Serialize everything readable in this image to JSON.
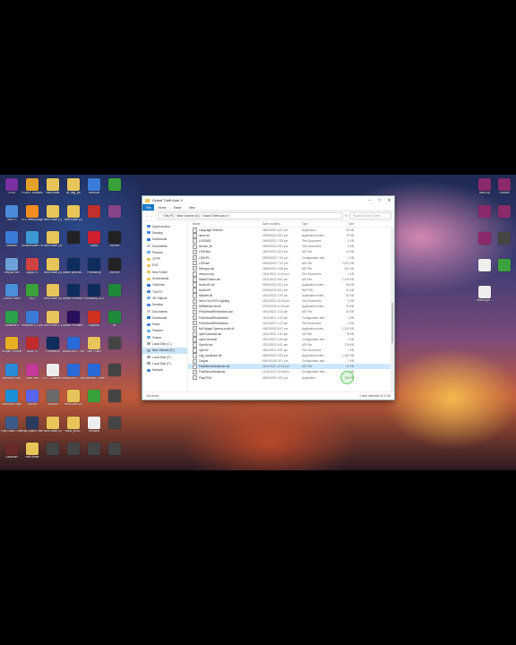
{
  "desktop": {
    "left_icons": [
      {
        "label": "CPUZ",
        "color": "#7a2fa0"
      },
      {
        "label": "PLANT Zombies",
        "color": "#e3a12b"
      },
      {
        "label": "New folder",
        "color": "#e8c55a"
      },
      {
        "label": "ctt_flag_jon",
        "color": "#e8c55a"
      },
      {
        "label": "onedrive",
        "color": "#3b7bd8"
      },
      {
        "label": "",
        "color": "#3aa23a"
      },
      {
        "label": "This PC",
        "color": "#4b8ad8"
      },
      {
        "label": "VLC media player",
        "color": "#f28c1e"
      },
      {
        "label": "New folder (2)",
        "color": "#e8c55a"
      },
      {
        "label": "New folder (3)",
        "color": "#e8c55a"
      },
      {
        "label": "",
        "color": "#c0302c"
      },
      {
        "label": "",
        "color": "#884488"
      },
      {
        "label": "Network",
        "color": "#3b7bd8"
      },
      {
        "label": "Wondershare Filmora9",
        "color": "#3c9bd6"
      },
      {
        "label": "New folder (4)",
        "color": "#e8c55a"
      },
      {
        "label": "",
        "color": "#222"
      },
      {
        "label": "Opera",
        "color": "#d02030"
      },
      {
        "label": "999999",
        "color": "#222"
      },
      {
        "label": "Recycle Bin",
        "color": "#6ea0d8"
      },
      {
        "label": "Zapya PC",
        "color": "#d04242"
      },
      {
        "label": "New folder (5)",
        "color": "#e8c55a"
      },
      {
        "label": "adobe photosh...",
        "color": "#0f2d5c"
      },
      {
        "label": "Photoshop",
        "color": "#0f2d5c"
      },
      {
        "label": "999999",
        "color": "#222"
      },
      {
        "label": "Control Panel",
        "color": "#4a90d8"
      },
      {
        "label": "2k22",
        "color": "#3aa23a"
      },
      {
        "label": "New folder (6)",
        "color": "#e8c55a"
      },
      {
        "label": "Adobe Photosh...",
        "color": "#0f2d5c"
      },
      {
        "label": "Photoshop 2021",
        "color": "#0f2d5c"
      },
      {
        "label": "",
        "color": "#1f8a3a"
      },
      {
        "label": "Camtasia 9",
        "color": "#2aa24a"
      },
      {
        "label": "Windows 10 Update As...",
        "color": "#3a7bd8"
      },
      {
        "label": "New folder (7)",
        "color": "#e8c55a"
      },
      {
        "label": "Adobe Premiere Pro",
        "color": "#2a0f5c"
      },
      {
        "label": "Anydesk",
        "color": "#d03020"
      },
      {
        "label": "Mr.",
        "color": "#1f8a3a"
      },
      {
        "label": "Google Chrome",
        "color": "#e8b020"
      },
      {
        "label": "5558770",
        "color": "#c02a2a"
      },
      {
        "label": "Photoshop",
        "color": "#0f2d5c"
      },
      {
        "label": "BandLink 8 - Shortcut",
        "color": "#2a6ad8"
      },
      {
        "label": "Vaio Folder",
        "color": "#e8c55a"
      },
      {
        "label": "",
        "color": "#444"
      },
      {
        "label": "Microsoft HUB",
        "color": "#2a8ad8"
      },
      {
        "label": "fresh new",
        "color": "#c43a9a"
      },
      {
        "label": "TEXT 2Maksim...",
        "color": "#eeeeee"
      },
      {
        "label": "BandLink 8 - Shortcut",
        "color": "#2a6ad8"
      },
      {
        "label": "Powerlink - Shortcut",
        "color": "#2a6ad8"
      },
      {
        "label": "",
        "color": "#444"
      },
      {
        "label": "Microsoft Edge",
        "color": "#1c8fd8"
      },
      {
        "label": "Discord",
        "color": "#5865f2"
      },
      {
        "label": "Gpucrier",
        "color": "#6a6a6a"
      },
      {
        "label": "New folder (8)",
        "color": "#e8c55a"
      },
      {
        "label": "",
        "color": "#3aa23a"
      },
      {
        "label": "",
        "color": "#444"
      },
      {
        "label": "Play Grand Theft Auto V",
        "color": "#3a5a8a"
      },
      {
        "label": "Play Grand Theft Auto V",
        "color": "#2a3a5a"
      },
      {
        "label": "New folder (9)",
        "color": "#e8c55a"
      },
      {
        "label": "extra_textu...",
        "color": "#e8c55a"
      },
      {
        "label": "Readme",
        "color": "#eeeeee"
      },
      {
        "label": "",
        "color": "#444"
      },
      {
        "label": "Launcher",
        "color": "#6a2a2a"
      },
      {
        "label": "New folder",
        "color": "#e8c55a"
      },
      {
        "label": "",
        "color": "#444"
      },
      {
        "label": "",
        "color": "#444"
      },
      {
        "label": "",
        "color": "#444"
      },
      {
        "label": "",
        "color": "#444"
      }
    ],
    "right_icons": [
      {
        "label": "New Zip",
        "color": "#8a2a6a"
      },
      {
        "label": "Fundoo",
        "color": "#8a2a6a"
      },
      {
        "label": "",
        "color": "#8a2a6a"
      },
      {
        "label": "",
        "color": "#8a2a6a"
      },
      {
        "label": "",
        "color": "#8a2a6a"
      },
      {
        "label": "",
        "color": "#444"
      },
      {
        "label": "",
        "color": "#eeeeee"
      },
      {
        "label": "",
        "color": "#3aa23a"
      },
      {
        "label": "heading-m...",
        "color": "#eeeeee"
      }
    ]
  },
  "window": {
    "title": "Grand Theft Auto V",
    "ribbon_tabs": [
      "File",
      "Home",
      "Share",
      "View"
    ],
    "path": "›  This PC  ›  New Volume (D:)  ›  Grand Theft Auto V  ›",
    "search_placeholder": "Search Grand Theft...",
    "nav_items": [
      {
        "label": "Quick access",
        "color": "#4b8ad8",
        "sel": false
      },
      {
        "label": "Desktop",
        "color": "#4b8ad8",
        "sel": false
      },
      {
        "label": "Downloads",
        "color": "#2a7ad8",
        "sel": false
      },
      {
        "label": "Documents",
        "color": "#c8c8c8",
        "sel": false
      },
      {
        "label": "Pictures",
        "color": "#6ab0e8",
        "sel": false
      },
      {
        "label": "CPPP",
        "color": "#e8c55a",
        "sel": false
      },
      {
        "label": "EXS",
        "color": "#e8c55a",
        "sel": false
      },
      {
        "label": "New Folder",
        "color": "#e8c55a",
        "sel": false
      },
      {
        "label": "Screenshots",
        "color": "#e8c55a",
        "sel": false
      },
      {
        "label": "OneDrive",
        "color": "#2a7ad8",
        "sel": false
      },
      {
        "label": "This PC",
        "color": "#4b8ad8",
        "sel": false
      },
      {
        "label": "3D Objects",
        "color": "#6ab0e8",
        "sel": false
      },
      {
        "label": "Desktop",
        "color": "#4b8ad8",
        "sel": false
      },
      {
        "label": "Documents",
        "color": "#c8c8c8",
        "sel": false
      },
      {
        "label": "Downloads",
        "color": "#2a7ad8",
        "sel": false
      },
      {
        "label": "Music",
        "color": "#4b8ad8",
        "sel": false
      },
      {
        "label": "Pictures",
        "color": "#6ab0e8",
        "sel": false
      },
      {
        "label": "Videos",
        "color": "#6ab0e8",
        "sel": false
      },
      {
        "label": "Local Disk (C:)",
        "color": "#9aa",
        "sel": false
      },
      {
        "label": "New Volume (D:)",
        "color": "#9aa",
        "sel": true
      },
      {
        "label": "Local Disk (E:)",
        "color": "#9aa",
        "sel": false
      },
      {
        "label": "Local Disk (F:)",
        "color": "#9aa",
        "sel": false
      },
      {
        "label": "Network",
        "color": "#4b8ad8",
        "sel": false
      }
    ],
    "columns": [
      "Name",
      "Date modified",
      "Type",
      "Size"
    ],
    "files": [
      {
        "name": "Language Selector",
        "date": "06/03/2021 6:21 pm",
        "type": "Application",
        "size": "36 KB"
      },
      {
        "name": "launc.dll",
        "date": "09/05/2022 8:22 pm",
        "type": "Application exten...",
        "size": "75 KB"
      },
      {
        "name": "LICENSE",
        "date": "16/09/2021 7:05 pm",
        "type": "Text Document",
        "size": "2 KB"
      },
      {
        "name": "license_en",
        "date": "25/09/2021 8:21 pm",
        "type": "Text Document",
        "size": "5 KB"
      },
      {
        "name": "LSDHelp",
        "date": "25/09/2021 8:21 pm",
        "type": "ASI File",
        "size": "12 KB"
      },
      {
        "name": "LSDHFL",
        "date": "09/05/2022 7:32 pm",
        "type": "Configuration sett...",
        "size": "1 KB"
      },
      {
        "name": "LSPulse",
        "date": "09/05/2022 7:13 pm",
        "type": "ASI File",
        "size": "2,041 KB"
      },
      {
        "name": "Mxtopps.asi",
        "date": "18/08/2021 9:08 pm",
        "type": "ASI File",
        "size": "200 KB"
      },
      {
        "name": "menyoo.log",
        "date": "16/11/2021 11:49 pm",
        "type": "Text Document",
        "size": "1 KB"
      },
      {
        "name": "NativeTrainer.asi",
        "date": "23/11/2021 8:01 pm",
        "type": "ASI File",
        "size": "1,149 KB"
      },
      {
        "name": "NoArchFl.dll",
        "date": "09/05/2022 8:01 pm",
        "type": "Application exten...",
        "size": "96 KB"
      },
      {
        "name": "NoArchFl",
        "date": "02/05/2019 8:21 pm",
        "type": "INIS File",
        "size": "41 KB"
      },
      {
        "name": "NiBullet.dll",
        "date": "16/11/2021 7:09 pm",
        "type": "Application exten...",
        "size": "92 KB"
      },
      {
        "name": "Neon Gun IPGI Lighting",
        "date": "16/11/2021 12:40 pm",
        "type": "Text Document",
        "size": "2 KB"
      },
      {
        "name": "NIBBMods.net.dll",
        "date": "07/09/2019 11:33 am",
        "type": "Application exten...",
        "size": "15 KB"
      },
      {
        "name": "PedLifeandRestrictions.asi",
        "date": "16/11/2021 1:02 pm",
        "type": "ASI File",
        "size": "92 KB"
      },
      {
        "name": "PedLifeandRestrictions",
        "date": "16/11/2021 1:02 pm",
        "type": "Configuration sett...",
        "size": "1 KB"
      },
      {
        "name": "PedLifeandRestrictions",
        "date": "16/11/2021 1:02 pm",
        "type": "Text Document",
        "size": "4 KB"
      },
      {
        "name": "NoFoliage Camera.scrhk.dll",
        "date": "09/05/2022 8:17 pm",
        "type": "Application exten...",
        "size": "1,242 KB"
      },
      {
        "name": "openCamera#.asi",
        "date": "16/11/2021 1:02 pm",
        "type": "ASI File",
        "size": "78 KB"
      },
      {
        "name": "openCamera#",
        "date": "25/11/2021 2:08 pm",
        "type": "Configuration sett...",
        "size": "1 KB"
      },
      {
        "name": "OpenIV.asi",
        "date": "13/11/2021 6:01 pm",
        "type": "ASI File",
        "size": "178 KB"
      },
      {
        "name": "OpenIV",
        "date": "18/11/2021 6:01 pm",
        "type": "Text Document",
        "size": "1 KB"
      },
      {
        "name": "orig_socialclub.dll",
        "date": "09/05/2022 8:22 pm",
        "type": "Application exten...",
        "size": "1,163 KB"
      },
      {
        "name": "Origins",
        "date": "09/04/2016 3:01 pm",
        "type": "Configuration sett...",
        "size": "1 KB"
      },
      {
        "name": "PackfileLimitAdjuster.asi",
        "date": "16/11/2021 12:43 pm",
        "type": "ASI File",
        "size": "42 KB",
        "sel": true
      },
      {
        "name": "PackfileLimitAdjuster",
        "date": "11/11/2021 12:48 pm",
        "type": "Configuration sett...",
        "size": "1 KB"
      },
      {
        "name": "PlayGTAV",
        "date": "09/05/2022 8:22 pm",
        "type": "Application",
        "size": "245 KB"
      }
    ],
    "status_left": "134 items",
    "status_right": "1 item selected 42.0 KB"
  }
}
